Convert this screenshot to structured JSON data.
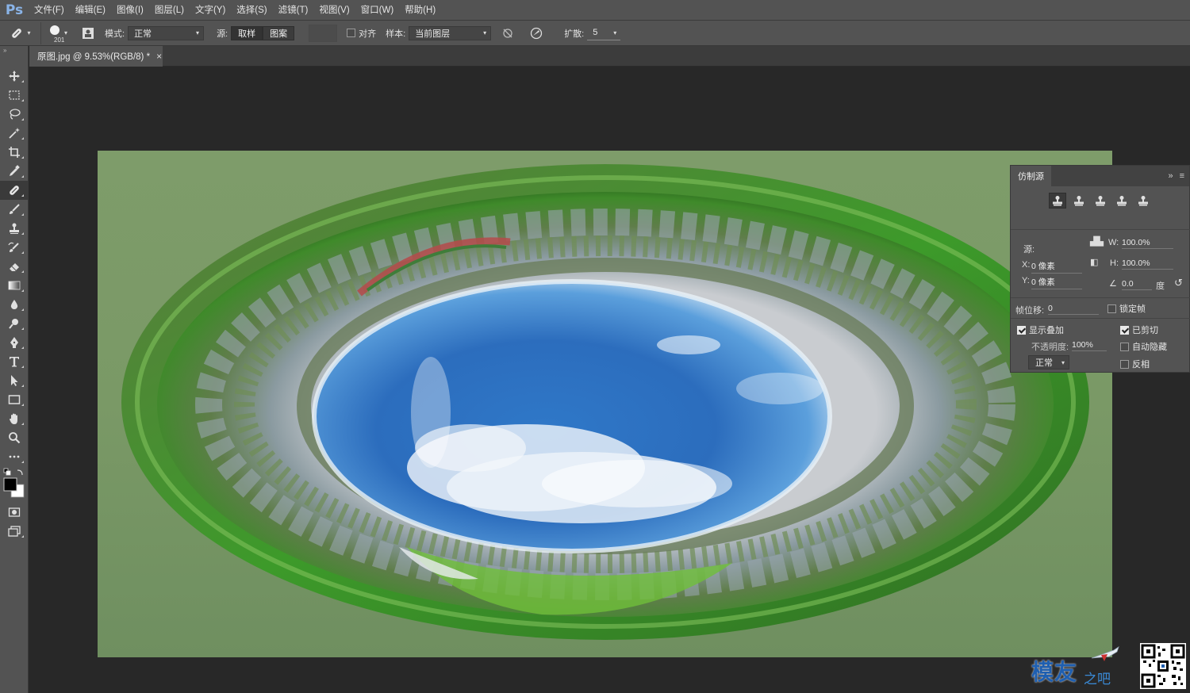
{
  "app": {
    "logo": "Ps",
    "menu": [
      "文件(F)",
      "编辑(E)",
      "图像(I)",
      "图层(L)",
      "文字(Y)",
      "选择(S)",
      "滤镜(T)",
      "视图(V)",
      "窗口(W)",
      "帮助(H)"
    ]
  },
  "options": {
    "brush_size": "201",
    "mode_label": "模式:",
    "mode_value": "正常",
    "source_label": "源:",
    "source_sampled": "取样",
    "source_pattern": "图案",
    "aligned_label": "对齐",
    "aligned_checked": false,
    "sample_label": "样本:",
    "sample_value": "当前图层",
    "diffusion_label": "扩散:",
    "diffusion_value": "5"
  },
  "document": {
    "tab_title": "原图.jpg @ 9.53%(RGB/8) *",
    "close_glyph": "×"
  },
  "clone_source_panel": {
    "title": "仿制源",
    "source_label": "源:",
    "w_label": "W:",
    "w_value": "100.0%",
    "h_label": "H:",
    "h_value": "100.0%",
    "x_label": "X:",
    "x_value": "0 像素",
    "y_label": "Y:",
    "y_value": "0 像素",
    "angle_value": "0.0",
    "angle_unit": "度",
    "frame_offset_label": "帧位移:",
    "frame_offset_value": "0",
    "lock_frame_label": "锁定帧",
    "show_overlay_label": "显示叠加",
    "opacity_label": "不透明度:",
    "opacity_value": "100%",
    "blend_value": "正常",
    "clipped_label": "已剪切",
    "auto_hide_label": "自动隐藏",
    "invert_label": "反相"
  },
  "watermark": {
    "text_main": "模友",
    "text_sub": "之吧"
  },
  "colors": {
    "foreground": "#000000",
    "background": "#ffffff",
    "accent_blue": "#1f5fb0",
    "panel": "#535353"
  }
}
